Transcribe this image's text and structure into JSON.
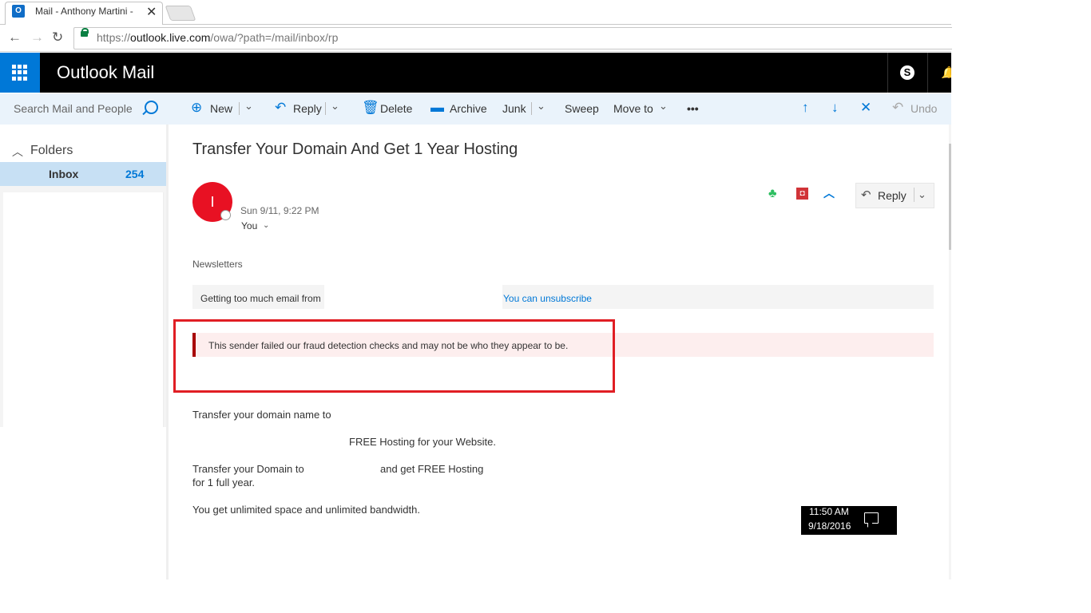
{
  "browser": {
    "tab_title": "Mail - Anthony Martini -",
    "tab_icon": "outlook-icon",
    "url_protocol": "https://",
    "url_host": "outlook.live.com",
    "url_path": "/owa/?path=/mail/inbox/rp"
  },
  "app": {
    "title": "Outlook Mail",
    "accent_color": "#0078d7"
  },
  "search": {
    "placeholder": "Search Mail and People"
  },
  "commands": {
    "new": "New",
    "reply": "Reply",
    "delete": "Delete",
    "archive": "Archive",
    "junk": "Junk",
    "sweep": "Sweep",
    "move_to": "Move to",
    "more": "•••",
    "undo": "Undo"
  },
  "sidebar": {
    "folders_label": "Folders",
    "inbox_label": "Inbox",
    "inbox_count": "254"
  },
  "message": {
    "subject": "Transfer Your Domain And Get 1 Year Hosting",
    "sender_initial": "I",
    "date": "Sun 9/11, 9:22 PM",
    "to": "You",
    "reply_label": "Reply",
    "category": "Newsletters",
    "unsubscribe_prompt": "Getting too much email from",
    "unsubscribe_link": "You can unsubscribe",
    "fraud_warning": "This sender failed our fraud detection checks and may not be who they appear to be.",
    "body": {
      "line1": "Transfer your domain name to",
      "line2": "FREE Hosting for your Website.",
      "line3a": "Transfer your Domain to",
      "line3b": "and get FREE Hosting",
      "line4": "for 1 full year.",
      "line5": "You get unlimited space and unlimited bandwidth."
    }
  },
  "taskbar": {
    "time": "11:50 AM",
    "date": "9/18/2016"
  }
}
